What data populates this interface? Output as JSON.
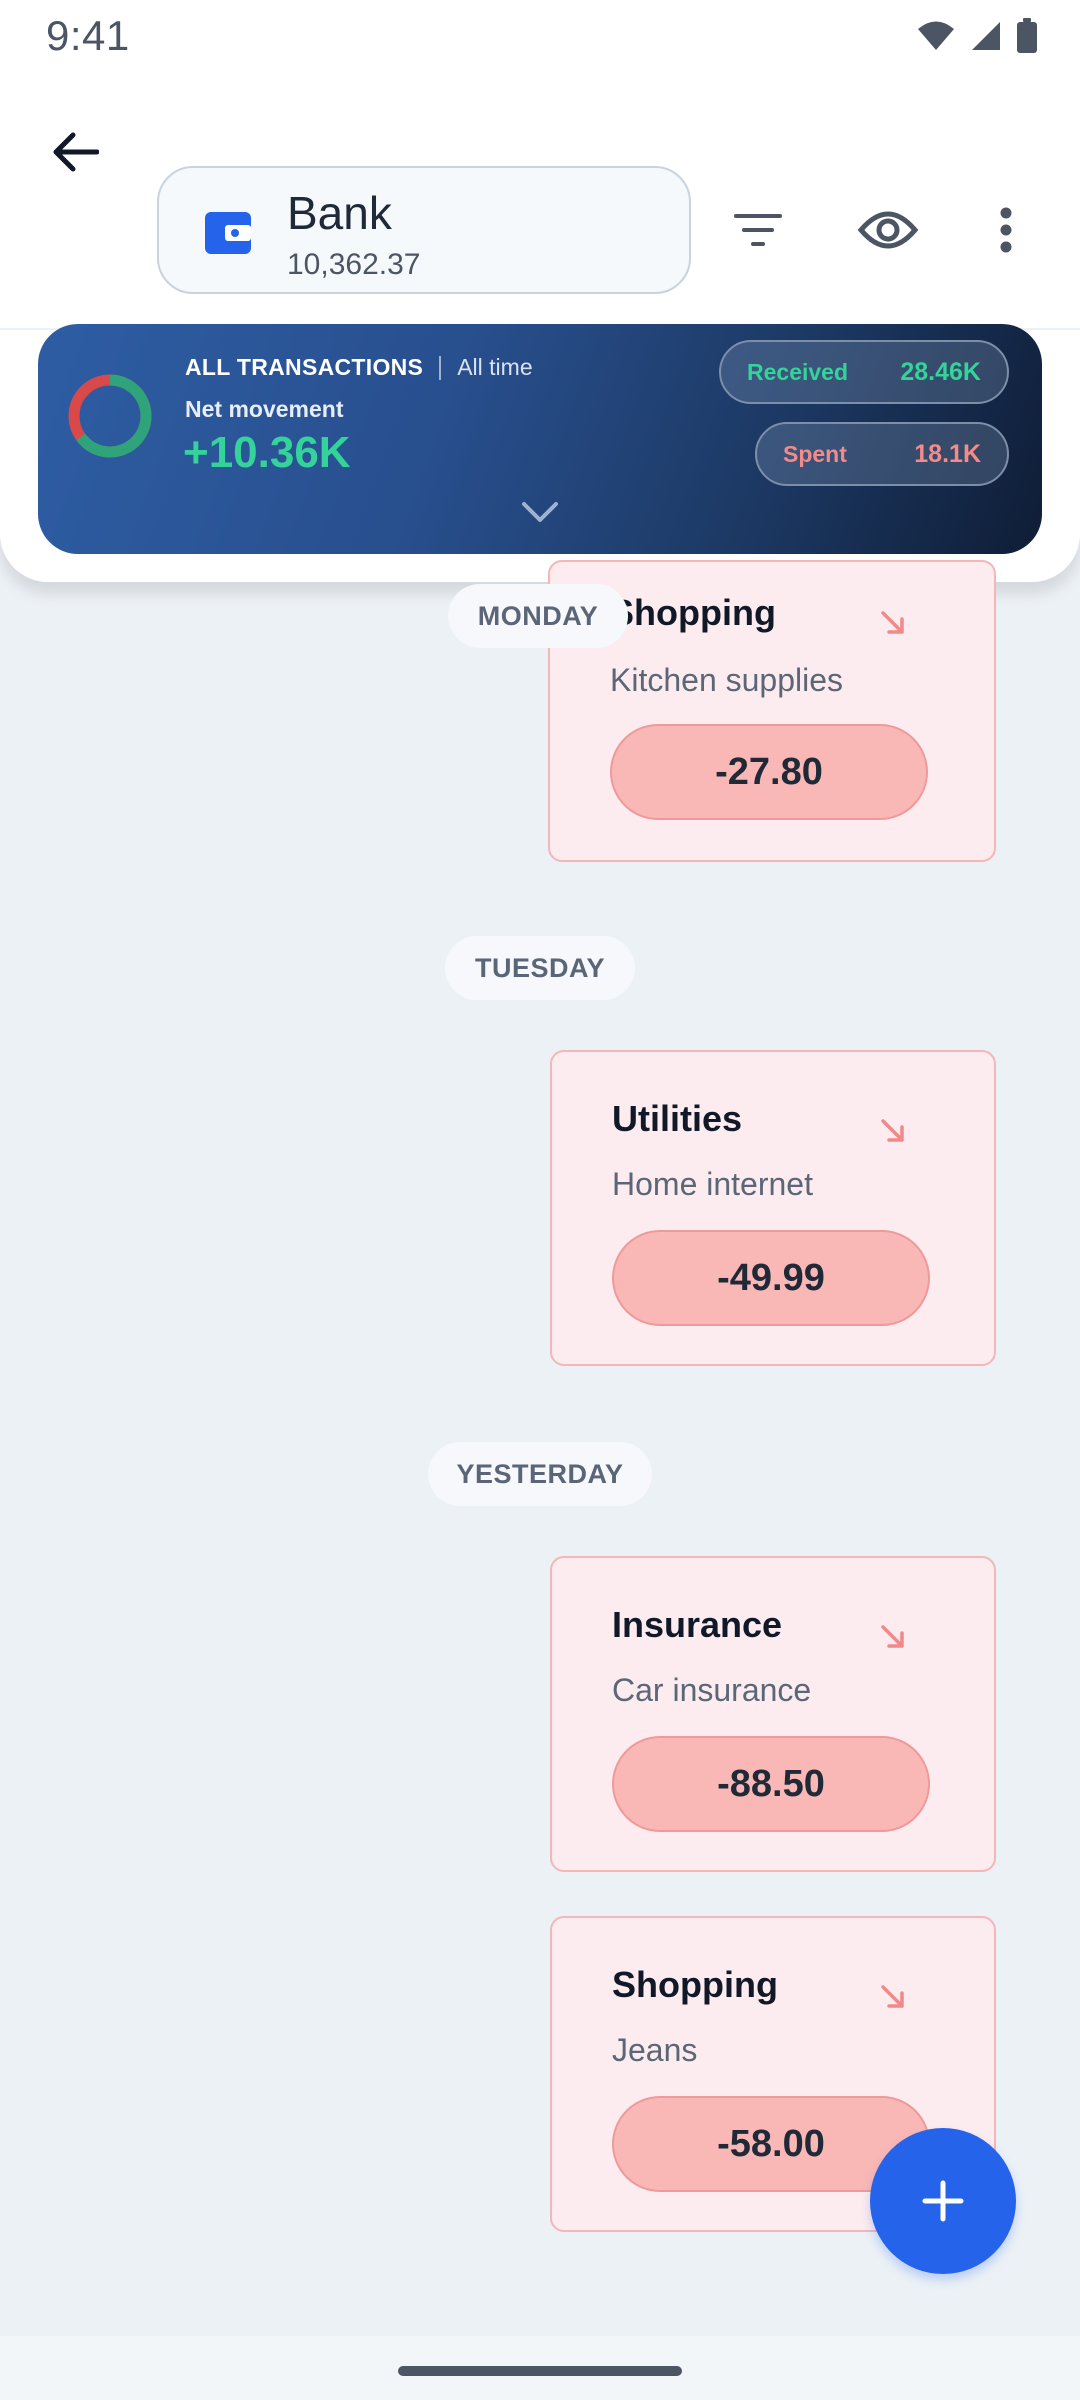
{
  "status_bar": {
    "time": "9:41"
  },
  "header": {
    "account_name": "Bank",
    "account_balance": "10,362.37",
    "icons": [
      "back-arrow-icon",
      "wallet-icon",
      "filter-icon",
      "eye-icon",
      "more-vert-icon"
    ]
  },
  "summary": {
    "title": "ALL TRANSACTIONS",
    "period": "All time",
    "net_label": "Net movement",
    "net_value": "+10.36K",
    "received_label": "Received",
    "received_value": "28.46K",
    "spent_label": "Spent",
    "spent_value": "18.1K",
    "colors": {
      "received": "#34d399",
      "spent": "#f48a8a"
    }
  },
  "groups": [
    {
      "day": "MONDAY",
      "transactions": [
        {
          "category": "Shopping",
          "description": "Kitchen supplies",
          "amount": "-27.80"
        }
      ]
    },
    {
      "day": "TUESDAY",
      "transactions": [
        {
          "category": "Utilities",
          "description": "Home internet",
          "amount": "-49.99"
        }
      ]
    },
    {
      "day": "YESTERDAY",
      "transactions": [
        {
          "category": "Insurance",
          "description": "Car insurance",
          "amount": "-88.50"
        },
        {
          "category": "Shopping",
          "description": "Jeans",
          "amount": "-58.00"
        }
      ]
    }
  ],
  "fab": {
    "icon": "plus-icon"
  },
  "colors": {
    "accent": "#2563eb",
    "expense_bg": "#fdecef",
    "expense_pill": "#f9b8b6"
  }
}
